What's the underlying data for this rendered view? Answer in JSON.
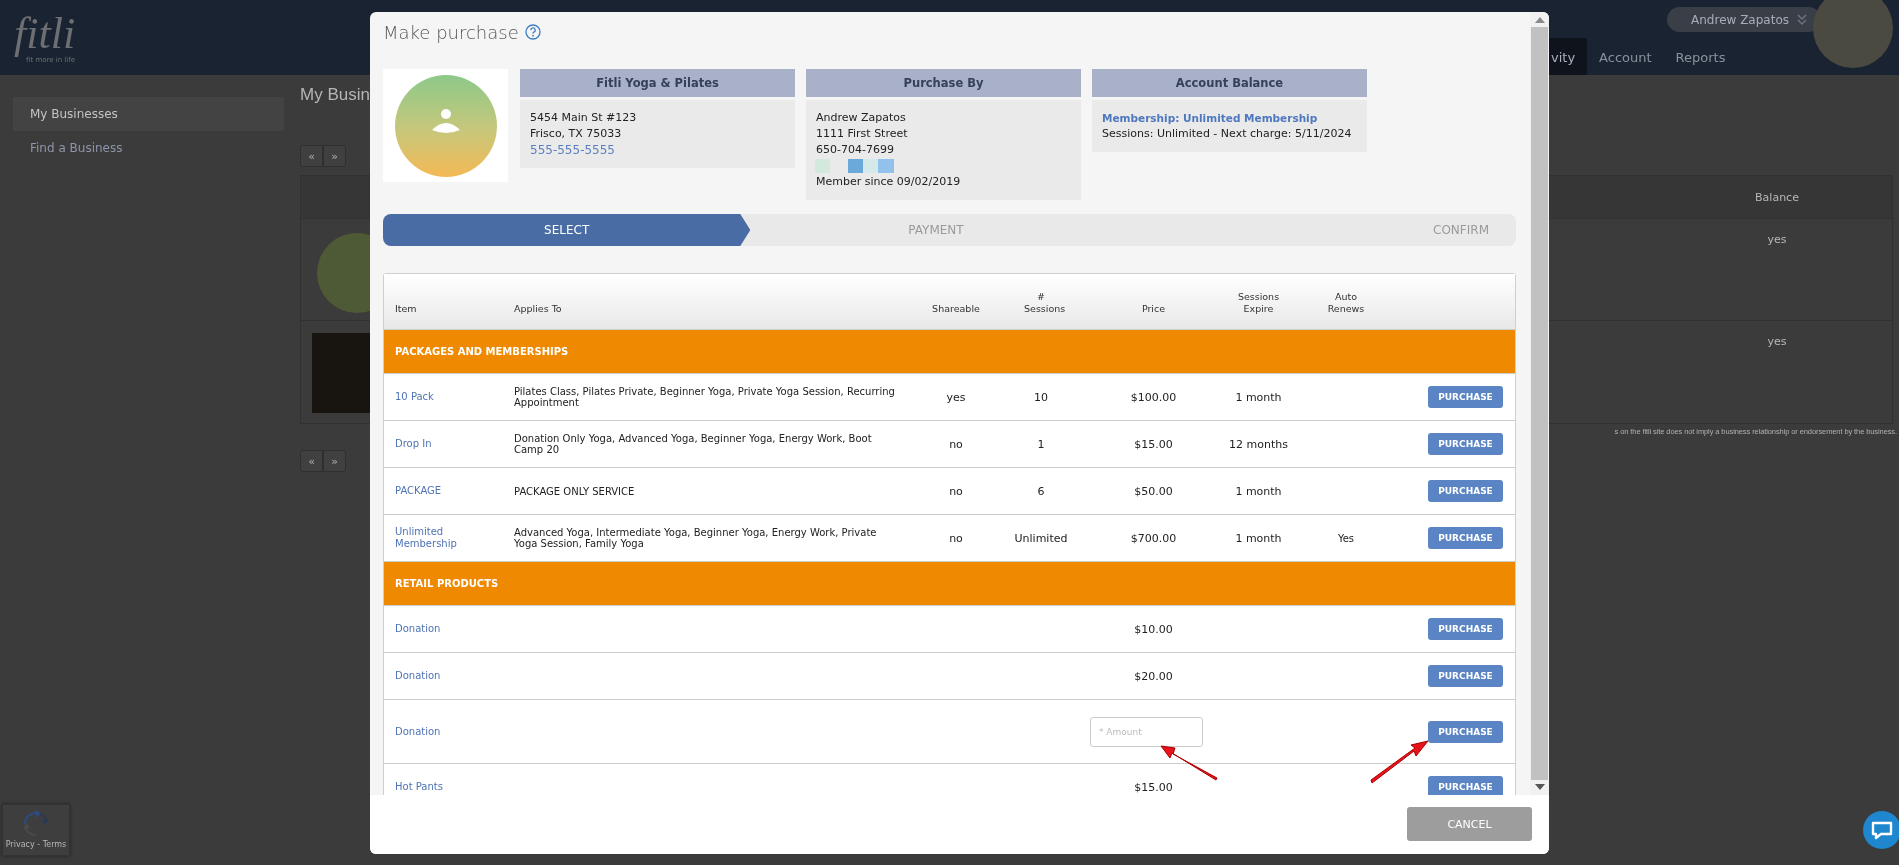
{
  "app": {
    "logo": "fitli",
    "tagline": "fit more in life",
    "user_menu": {
      "name": "Andrew Zapatos"
    },
    "nav": [
      {
        "label": "vity",
        "selected": true
      },
      {
        "label": "Account",
        "selected": false
      },
      {
        "label": "Reports",
        "selected": false
      }
    ]
  },
  "sidebar": {
    "items": [
      {
        "label": "My Businesses",
        "selected": true
      },
      {
        "label": "Find a Business",
        "selected": false
      }
    ]
  },
  "page": {
    "title": "My Busin",
    "pager": [
      {
        "label": "«"
      },
      {
        "label": "»"
      }
    ],
    "table": {
      "columns": [
        "Balance"
      ],
      "rows": [
        {
          "balance": "yes",
          "kind": "round"
        },
        {
          "balance": "yes",
          "kind": "square"
        }
      ]
    },
    "footnote": "s on the fitli site does not imply a business relationship or endorsement by the business."
  },
  "recaptcha": {
    "text": "Privacy - Terms"
  },
  "dialog": {
    "title": "Make purchase",
    "business": {
      "heading": "Fitli Yoga & Pilates",
      "lines": [
        "5454 Main St #123",
        "Frisco, TX 75033"
      ],
      "phone": "555-555-5555"
    },
    "purchaser": {
      "heading": "Purchase By",
      "lines": [
        "Andrew Zapatos",
        "1111 First Street",
        "650-704-7699"
      ],
      "member_since": "Member since 09/02/2019"
    },
    "balance": {
      "heading": "Account Balance",
      "membership": "Membership: Unlimited Membership",
      "detail": "Sessions: Unlimited -  Next charge: 5/11/2024"
    },
    "steps": [
      {
        "label": "SELECT",
        "selected": true
      },
      {
        "label": "PAYMENT",
        "selected": false
      },
      {
        "label": "CONFIRM",
        "selected": false
      }
    ],
    "table": {
      "columns": [
        "Item",
        "Applies To",
        "Shareable",
        "# Sessions",
        "Price",
        "Sessions Expire",
        "Auto Renews"
      ],
      "sections": [
        {
          "title": "PACKAGES AND MEMBERSHIPS",
          "rows": [
            {
              "kind": "price",
              "item": "10 Pack",
              "applies_to": "Pilates Class, Pilates Private, Beginner Yoga, Private Yoga Session, Recurring Appointment",
              "shareable": "yes",
              "sessions": "10",
              "price": "$100.00",
              "expire": "1 month",
              "button": "PURCHASE"
            },
            {
              "kind": "price",
              "item": "Drop In",
              "applies_to": "Donation Only Yoga, Advanced Yoga, Beginner Yoga, Energy Work, Boot Camp 20",
              "shareable": "no",
              "sessions": "1",
              "price": "$15.00",
              "expire": "12 months",
              "button": "PURCHASE"
            },
            {
              "kind": "price",
              "item": "PACKAGE",
              "applies_to": "PACKAGE ONLY SERVICE",
              "shareable": "no",
              "sessions": "6",
              "price": "$50.00",
              "expire": "1 month",
              "button": "PURCHASE"
            },
            {
              "kind": "price",
              "item": "Unlimited Membership",
              "applies_to": "Advanced Yoga, Intermediate Yoga, Beginner Yoga, Energy Work, Private Yoga Session, Family Yoga",
              "shareable": "no",
              "sessions": "Unlimited",
              "price": "$700.00",
              "expire": "1 month",
              "auto_renews": "Yes",
              "button": "PURCHASE"
            }
          ]
        },
        {
          "title": "RETAIL PRODUCTS",
          "rows": [
            {
              "kind": "price",
              "item": "Donation",
              "price": "$10.00",
              "button": "PURCHASE"
            },
            {
              "kind": "price",
              "item": "Donation",
              "price": "$20.00",
              "button": "PURCHASE"
            },
            {
              "kind": "amount",
              "item": "Donation",
              "placeholder": "* Amount",
              "button": "PURCHASE"
            },
            {
              "kind": "price",
              "item": "Hot Pants",
              "price": "$15.00",
              "button": "PURCHASE"
            }
          ]
        }
      ]
    },
    "cancel": "CANCEL"
  }
}
